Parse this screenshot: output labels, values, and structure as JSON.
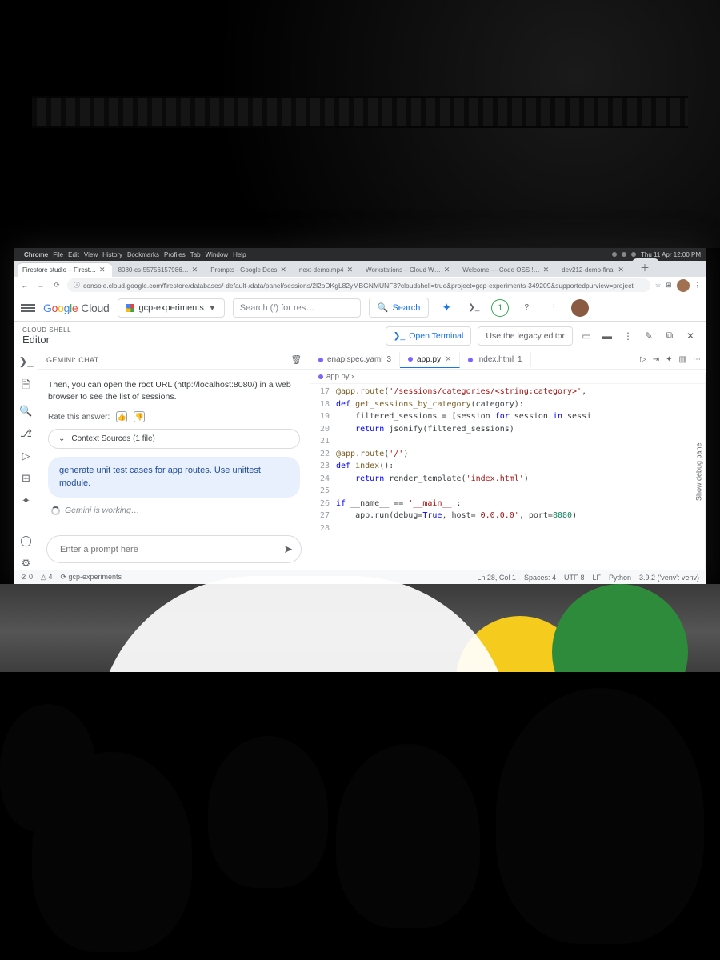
{
  "mac_menu": {
    "app": "Chrome",
    "items": [
      "File",
      "Edit",
      "View",
      "History",
      "Bookmarks",
      "Profiles",
      "Tab",
      "Window",
      "Help"
    ],
    "clock": "Thu 11 Apr  12:00 PM"
  },
  "browser": {
    "tabs": [
      {
        "title": "Firestore studio – Firest…",
        "active": true
      },
      {
        "title": "8080-cs-55756157986…",
        "active": false
      },
      {
        "title": "Prompts - Google Docs",
        "active": false
      },
      {
        "title": "next-demo.mp4",
        "active": false
      },
      {
        "title": "Workstations – Cloud W…",
        "active": false
      },
      {
        "title": "Welcome — Code OSS !…",
        "active": false
      },
      {
        "title": "dev212-demo-final",
        "active": false
      }
    ],
    "url": "console.cloud.google.com/firestore/databases/-default-/data/panel/sessions/2l2oDKgL82yMBGNMUNF3?cloudshell=true&project=gcp-experiments-349209&supportedpurview=project",
    "star": "☆"
  },
  "gcp_header": {
    "brand": "Google Cloud",
    "project": "gcp-experiments",
    "search_placeholder": "Search (/) for res…",
    "search_button": "Search",
    "badge": "1"
  },
  "shell_header": {
    "eyebrow": "CLOUD SHELL",
    "title": "Editor",
    "open_terminal": "Open Terminal",
    "legacy": "Use the legacy editor"
  },
  "chat": {
    "tab": "GEMINI: CHAT",
    "answer": "Then, you can open the root URL (http://localhost:8080/) in a web browser to see the list of sessions.",
    "rate_label": "Rate this answer:",
    "context": "Context Sources (1 file)",
    "user_prompt": "generate unit test cases for app routes. Use unittest module.",
    "working": "Gemini is working…",
    "input_placeholder": "Enter a prompt here"
  },
  "editor": {
    "tabs": [
      {
        "name": "enapispec.yaml",
        "badge": "3",
        "active": false
      },
      {
        "name": "app.py",
        "active": true
      },
      {
        "name": "index.html",
        "badge": "1",
        "active": false
      }
    ],
    "breadcrumb": "app.py › …",
    "debug_panel": "Show debug panel",
    "lines": [
      {
        "n": 17,
        "html": "<span class='dec'>@app.route</span>(<span class='str'>'/sessions/categories/&lt;string:category&gt;'</span>,"
      },
      {
        "n": 18,
        "html": "<span class='kw'>def</span> <span class='fn'>get_sessions_by_category</span>(category):"
      },
      {
        "n": 19,
        "html": "    filtered_sessions = [session <span class='kw'>for</span> session <span class='kw'>in</span> sessi"
      },
      {
        "n": 20,
        "html": "    <span class='kw'>return</span> jsonify(filtered_sessions)"
      },
      {
        "n": 21,
        "html": ""
      },
      {
        "n": 22,
        "html": "<span class='dec'>@app.route</span>(<span class='str'>'/'</span>)"
      },
      {
        "n": 23,
        "html": "<span class='kw'>def</span> <span class='fn'>index</span>():"
      },
      {
        "n": 24,
        "html": "    <span class='kw'>return</span> render_template(<span class='str'>'index.html'</span>)"
      },
      {
        "n": 25,
        "html": ""
      },
      {
        "n": 26,
        "html": "<span class='kw'>if</span> __name__ == <span class='str'>'__main__'</span>:"
      },
      {
        "n": 27,
        "html": "    app.run(debug=<span class='kw'>True</span>, host=<span class='str'>'0.0.0.0'</span>, port=<span class='num'>8080</span>)"
      },
      {
        "n": 28,
        "html": ""
      }
    ]
  },
  "status": {
    "left": [
      "⊘ 0",
      "△ 4",
      "⟳ gcp-experiments"
    ],
    "right": [
      "Ln 28, Col 1",
      "Spaces: 4",
      "UTF-8",
      "LF",
      "Python",
      "3.9.2 ('venv': venv)"
    ]
  }
}
